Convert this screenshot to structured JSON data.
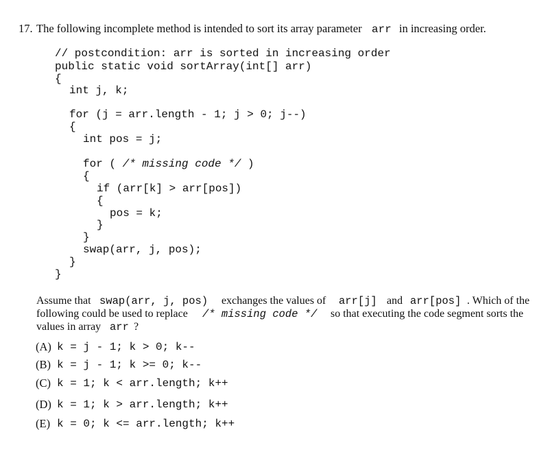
{
  "question": {
    "number": "17.",
    "stem_before": "The following incomplete method is intended to sort its array parameter",
    "stem_code": "arr",
    "stem_after": "in increasing order."
  },
  "code": {
    "lines": [
      "// postcondition: arr is sorted in increasing order",
      "public static void sortArray(int[] arr)",
      "{",
      "int j, k;",
      "for (j = arr.length - 1; j > 0; j--)",
      "{",
      "int pos = j;",
      "for ( /* missing code */ )",
      "{",
      "if (arr[k] > arr[pos])",
      "{",
      "pos = k;",
      "}",
      "}",
      "swap(arr, j, pos);",
      "}",
      "}"
    ]
  },
  "paragraph": {
    "l1_a": "Assume that",
    "l1_code1": "swap(arr, j, pos)",
    "l1_b": "exchanges the values of",
    "l1_code2": "arr[j]",
    "l1_c": "and",
    "l1_code3": "arr[pos]",
    "l1_d": ". Which of the",
    "l2_a": "following could be used to replace",
    "l2_code": "/* missing code */",
    "l2_b": "so that executing the code segment sorts the",
    "l3_a": "values in array",
    "l3_code": "arr",
    "l3_b": "?"
  },
  "options": [
    {
      "label": "(A)",
      "code": "k = j - 1; k > 0; k--"
    },
    {
      "label": "(B)",
      "code": "k = j - 1; k >= 0; k--"
    },
    {
      "label": "(C)",
      "code": "k = 1; k < arr.length; k++"
    },
    {
      "label": "(D)",
      "code": "k = 1; k > arr.length; k++"
    },
    {
      "label": "(E)",
      "code": "k = 0; k <= arr.length; k++"
    }
  ]
}
